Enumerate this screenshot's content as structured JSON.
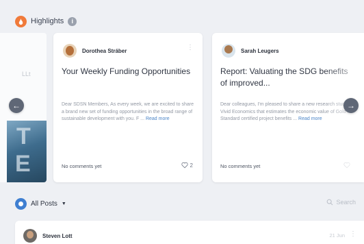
{
  "highlights": {
    "title": "Highlights",
    "info_icon": "i"
  },
  "ghost_card": {
    "text": "LLt",
    "image_glyphs": [
      "T",
      "E"
    ]
  },
  "cards": [
    {
      "author": "Dorothea Stráber",
      "title": "Your Weekly Funding Opportunities",
      "excerpt": "Dear SDSN Members, As every week, we are excited to share a brand new set of funding opportunities in the broad range of sustainable development with you. F ...",
      "read_more": "Read more",
      "comments": "No comments yet",
      "likes": "2"
    },
    {
      "author": "Sarah Leugers",
      "title": "Report: Valuating the SDG benefits of improved...",
      "excerpt": "Dear colleagues, I'm pleased to share a new research study by Vivid Economics that estimates the economic value of Gold Standard certified project benefits ...",
      "read_more": "Read more",
      "comments": "No comments yet",
      "likes": ""
    }
  ],
  "nav": {
    "prev": "←",
    "next": "→"
  },
  "filter": {
    "label": "All Posts",
    "caret": "▼",
    "search_placeholder": "Search"
  },
  "list": {
    "author": "Steven Lott",
    "time": "21 Jun"
  },
  "colors": {
    "highlight_badge": "#f07a3a",
    "posts_badge": "#3f7fd1",
    "read_more": "#4a84c7"
  }
}
